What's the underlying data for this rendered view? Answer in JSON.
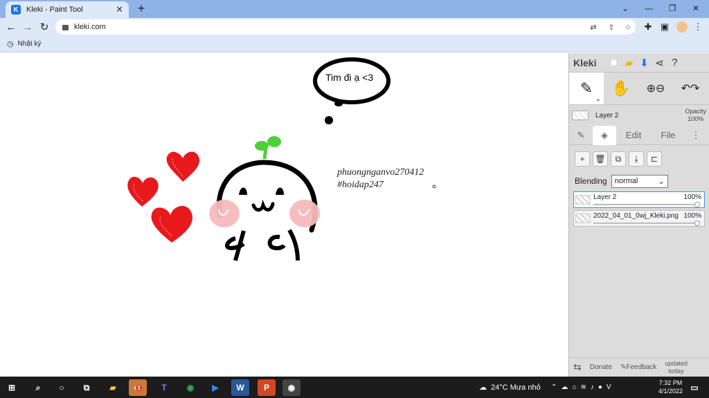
{
  "browser": {
    "tab_title": "Kleki - Paint Tool",
    "tab_favicon": "K",
    "url": "kleki.com",
    "bookmark_label": "Nhật ký"
  },
  "canvas": {
    "bubble_text": "Tim đi ạ <3",
    "watermark_line1": "phuongnganvo270412",
    "watermark_line2": "#hoidap247",
    "colors": {
      "heart": "#e8191d",
      "sprout": "#4ecf3b",
      "cheek": "#f6b9bc",
      "ink": "#000000"
    }
  },
  "panel": {
    "logo": "Kleki",
    "layer_current": "Layer 2",
    "opacity_label": "Opacity",
    "opacity_value": "100%",
    "tabs": {
      "edit": "Edit",
      "file": "File"
    },
    "blending_label": "Blending",
    "blending_value": "normal",
    "layers": [
      {
        "name": "Layer 2",
        "opacity": "100%"
      },
      {
        "name": "2022_04_01_0wj_Kleki.png",
        "opacity": "100%"
      }
    ],
    "footer": {
      "donate": "Donate",
      "feedback": "Feedback",
      "updated_line1": "updated",
      "updated_line2": "today"
    }
  },
  "taskbar": {
    "weather": "24°C  Mưa nhỏ",
    "time": "7:32 PM",
    "date": "4/1/2022",
    "badge": "1"
  }
}
